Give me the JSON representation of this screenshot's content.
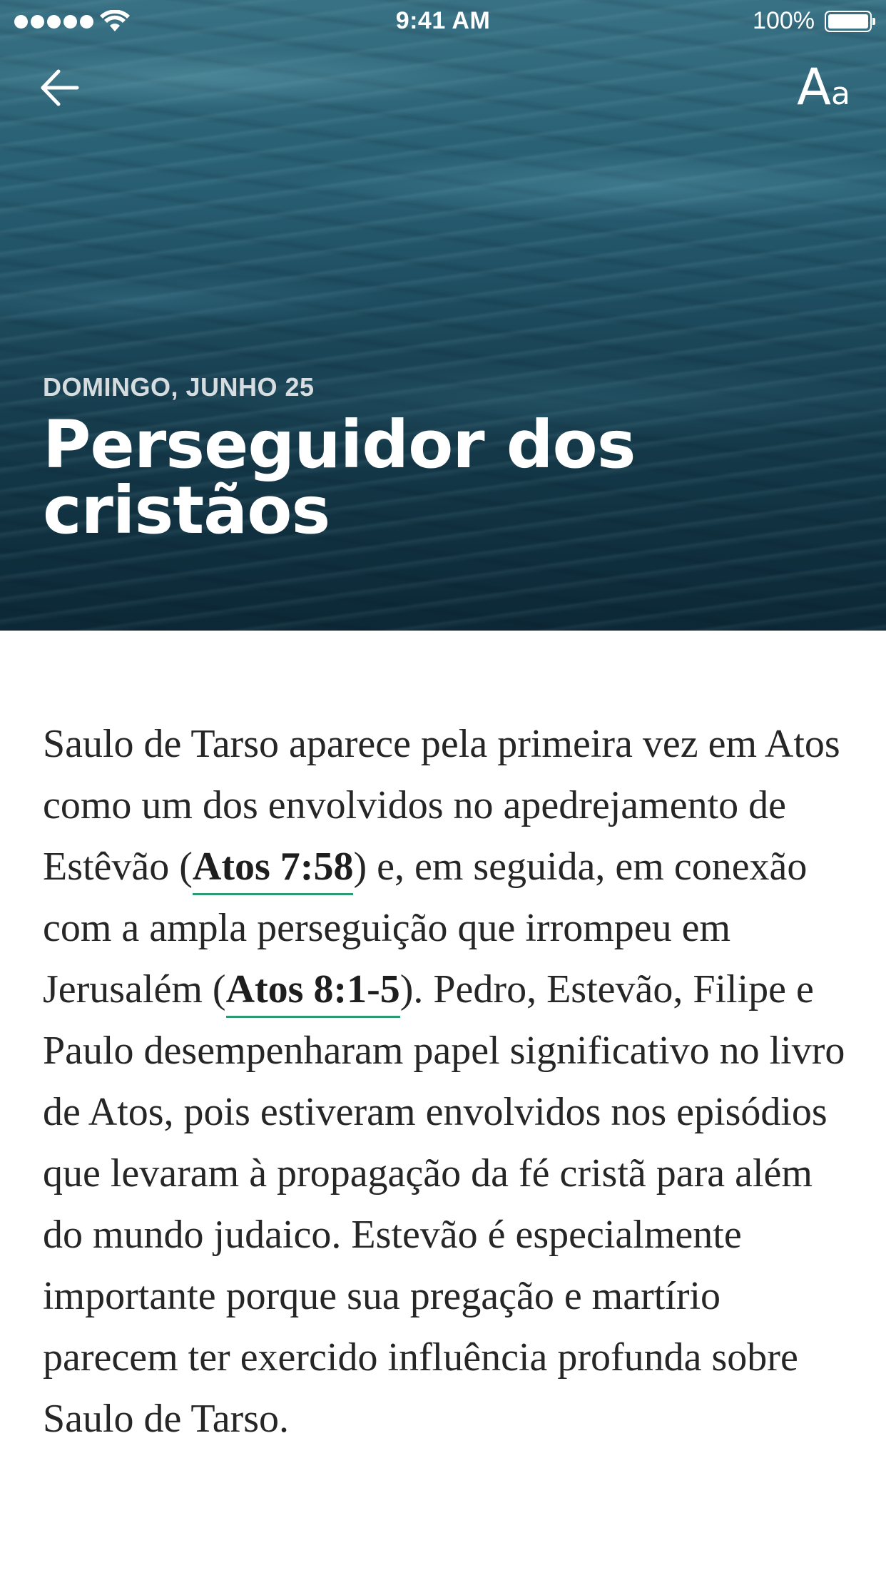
{
  "status_bar": {
    "time": "9:41 AM",
    "battery": "100%"
  },
  "header": {
    "back_icon": "arrow-left-icon",
    "font_size_big": "A",
    "font_size_small": "a",
    "date": "DOMINGO, JUNHO 25",
    "title": "Perseguidor dos cristãos"
  },
  "colors": {
    "link_underline": "#2d9b72",
    "body_text": "#262626",
    "hero_water": "#1f4f63"
  },
  "article": {
    "text_1": "Saulo de Tarso aparece pela primeira vez em Atos como um dos envolvidos no apedrejamento de Estêvão (",
    "ref_1": "Atos 7:58",
    "text_2": ") e, em seguida, em conexão com a ampla perseguição que irrompeu em Jerusalém (",
    "ref_2": "Atos 8:1-5",
    "text_3": "). Pedro, Estevão, Filipe e Paulo desempenharam papel significativo no livro de Atos, pois estiveram envolvidos nos episódios que levaram à propagação da fé cristã para além do mundo judaico. Estevão é especialmente importante porque sua pregação e martírio parecem ter exercido influência profunda sobre Saulo de Tarso."
  }
}
